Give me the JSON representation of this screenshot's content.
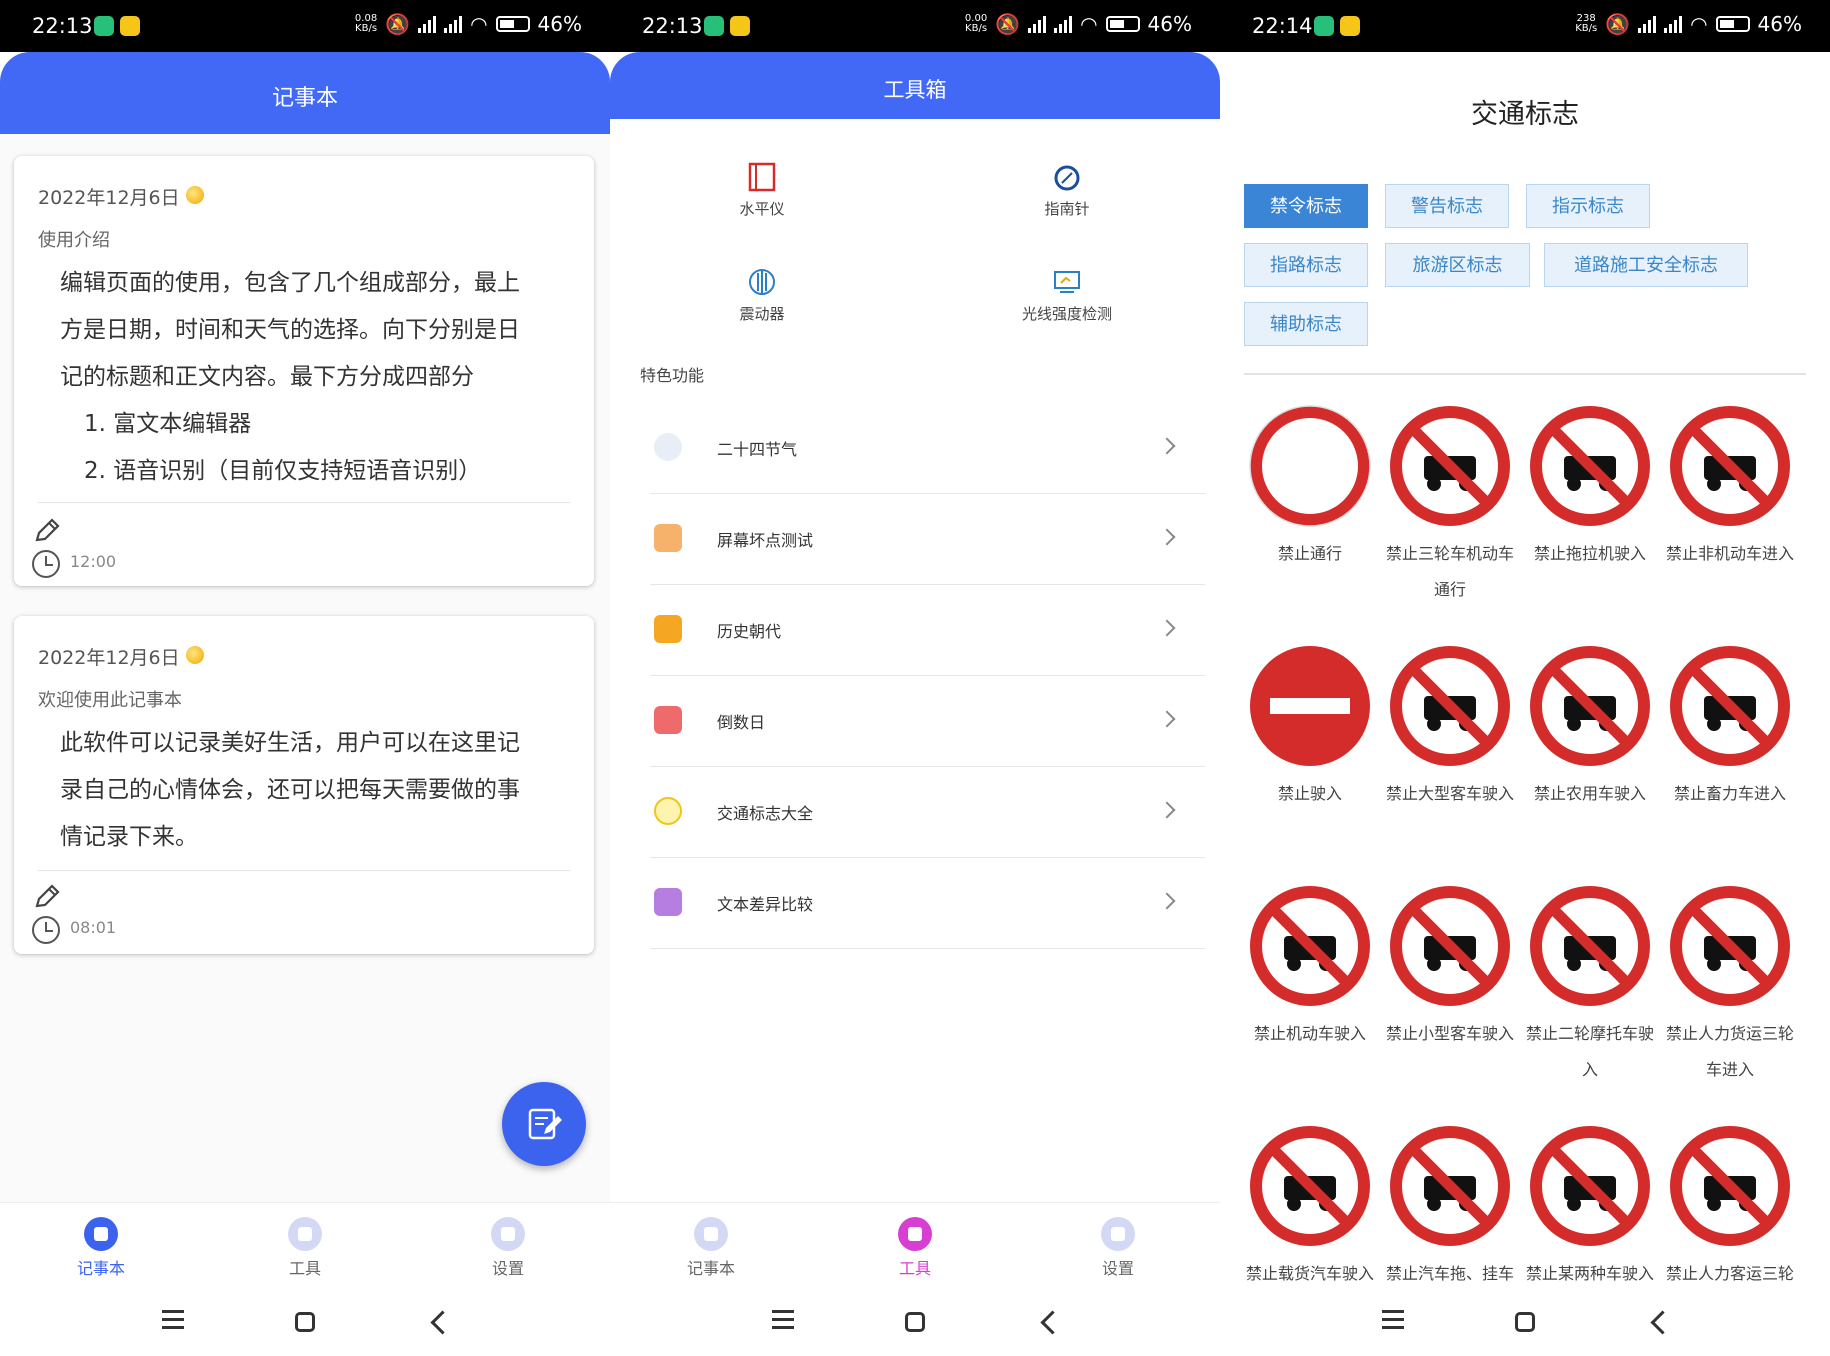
{
  "status_bars": [
    {
      "time": "22:13",
      "speed_top": "0.08",
      "speed_unit": "KB/s",
      "battery": "46%"
    },
    {
      "time": "22:13",
      "speed_top": "0.00",
      "speed_unit": "KB/s",
      "battery": "46%"
    },
    {
      "time": "22:14",
      "speed_top": "238",
      "speed_unit": "KB/s",
      "battery": "46%"
    }
  ],
  "notebook": {
    "title": "记事本",
    "cards": [
      {
        "date": "2022年12月6日",
        "title": "使用介绍",
        "body_lines": [
          "编辑页面的使用，包含了几个组成部分，最上",
          "方是日期，时间和天气的选择。向下分别是日",
          "记的标题和正文内容。最下方分成四部分"
        ],
        "list_items": [
          "1.   富文本编辑器",
          "2.   语音识别（目前仅支持短语音识别）"
        ],
        "time": "12:00"
      },
      {
        "date": "2022年12月6日",
        "title": "欢迎使用此记事本",
        "body_lines": [
          "此软件可以记录美好生活，用户可以在这里记",
          "录自己的心情体会，还可以把每天需要做的事",
          "情记录下来。"
        ],
        "list_items": [],
        "time": "08:01"
      }
    ]
  },
  "toolbox": {
    "title": "工具箱",
    "tools": [
      "水平仪",
      "指南针",
      "震动器",
      "光线强度检测"
    ],
    "section_label": "特色功能",
    "features": [
      "二十四节气",
      "屏幕坏点测试",
      "历史朝代",
      "倒数日",
      "交通标志大全",
      "文本差异比较"
    ]
  },
  "traffic": {
    "title": "交通标志",
    "tabs": [
      "禁令标志",
      "警告标志",
      "指示标志",
      "指路标志",
      "旅游区标志",
      "道路施工安全标志",
      "辅助标志"
    ],
    "signs": [
      [
        "禁止通行",
        "禁止三轮车机动车",
        "通行"
      ],
      [
        "禁止拖拉机驶入"
      ],
      [
        "禁止非机动车进入"
      ],
      [
        "禁止驶入"
      ],
      [
        "禁止大型客车驶入"
      ],
      [
        "禁止农用车驶入"
      ],
      [
        "禁止畜力车进入"
      ],
      [
        "禁止机动车驶入"
      ],
      [
        "禁止小型客车驶入"
      ],
      [
        "禁止二轮摩托车驶",
        "入"
      ],
      [
        "禁止人力货运三轮",
        "车进入"
      ],
      [
        "禁止载货汽车驶入"
      ],
      [
        "禁止汽车拖、挂车"
      ],
      [
        "禁止某两种车驶入"
      ],
      [
        "禁止人力客运三轮"
      ]
    ],
    "sign_names": [
      "禁止通行",
      "禁止三轮车机动车",
      "禁止拖拉机驶入",
      "禁止非机动车进入",
      "禁止驶入",
      "禁止大型客车驶入",
      "禁止农用车驶入",
      "禁止畜力车进入",
      "禁止机动车驶入",
      "禁止小型客车驶入",
      "禁止二轮摩托车驶",
      "禁止人力货运三轮",
      "禁止载货汽车驶入",
      "禁止汽车拖、挂车",
      "禁止某两种车驶入",
      "禁止人力客运三轮"
    ],
    "sign_name_second_lines": [
      "",
      "通行",
      "",
      "",
      "",
      "",
      "",
      "",
      "",
      "",
      "入",
      "车进入",
      "",
      "",
      "",
      ""
    ]
  },
  "bottom_nav": [
    "记事本",
    "工具",
    "设置"
  ],
  "colors": {
    "header_blue": "#4169f5",
    "tab_active": "#3b85d6",
    "sign_red": "#d42b2b",
    "nav_pink": "#d63fd1"
  }
}
